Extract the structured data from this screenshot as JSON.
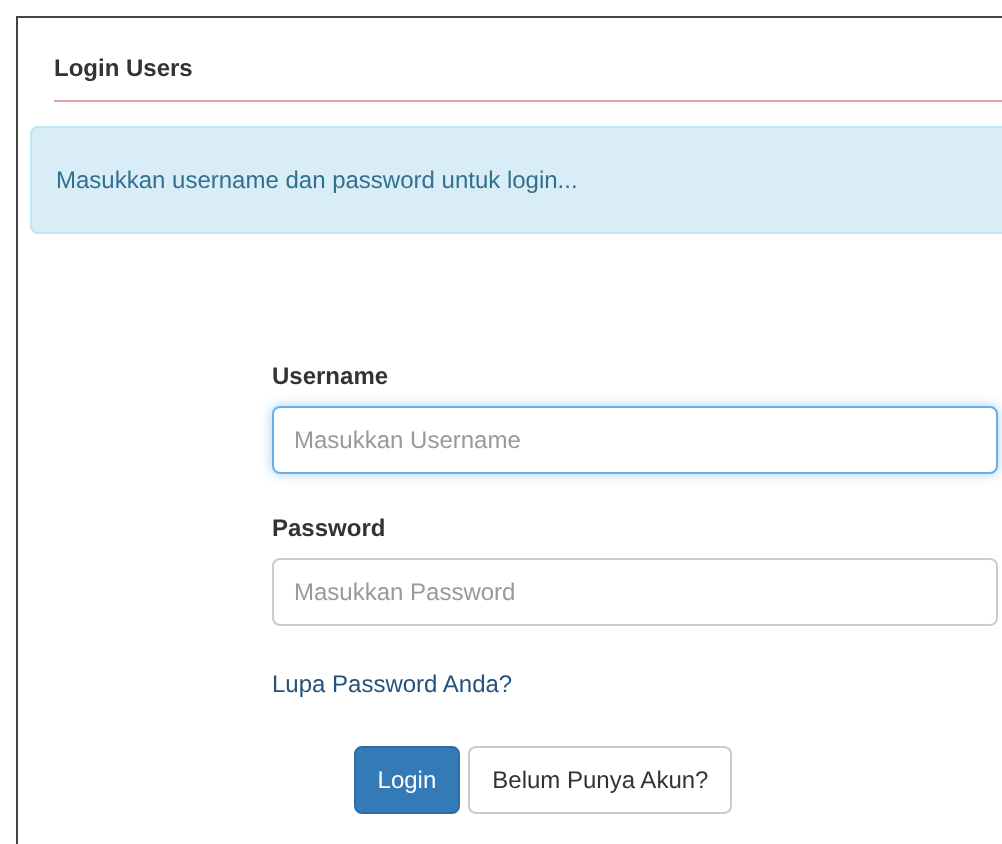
{
  "panel": {
    "title": "Login Users"
  },
  "alert": {
    "message": "Masukkan username dan password untuk login..."
  },
  "fields": [
    {
      "label": "Username",
      "placeholder": "Masukkan Username",
      "focused": true
    },
    {
      "label": "Password",
      "placeholder": "Masukkan Password",
      "focused": false
    }
  ],
  "link": "Lupa Password Anda?",
  "buttons": [
    {
      "label": "Login",
      "kind": "primary"
    },
    {
      "label": "Belum Punya Akun?",
      "kind": "default"
    }
  ]
}
